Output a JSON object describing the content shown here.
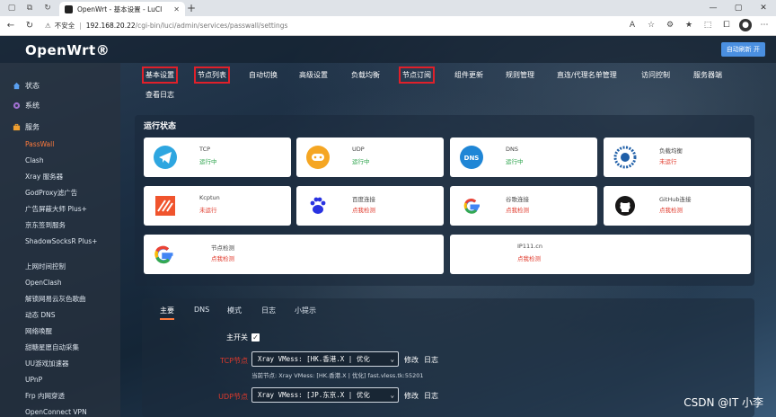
{
  "browser": {
    "tab_title": "OpenWrt - 基本设置 - LuCI",
    "url_warning": "不安全",
    "url_host": "192.168.20.22",
    "url_path": "/cgi-bin/luci/admin/services/passwall/settings"
  },
  "header": {
    "brand": "OpenWrt®",
    "auto_refresh": "自动刷新 开"
  },
  "sidebar": {
    "items": [
      {
        "label": "状态"
      },
      {
        "label": "系统"
      },
      {
        "label": "服务"
      }
    ],
    "services": [
      {
        "label": "PassWall"
      },
      {
        "label": "Clash"
      },
      {
        "label": "Xray 服务器"
      },
      {
        "label": "GodProxy滤广告"
      },
      {
        "label": "广告屏蔽大师 Plus+"
      },
      {
        "label": "京东签到服务"
      },
      {
        "label": "ShadowSocksR Plus+"
      },
      {
        "label": "上网时间控制"
      },
      {
        "label": "OpenClash"
      },
      {
        "label": "解锁网易云灰色歌曲"
      },
      {
        "label": "动态 DNS"
      },
      {
        "label": "网络唤醒"
      },
      {
        "label": "甜糖星愿自动采集"
      },
      {
        "label": "UU游戏加速器"
      },
      {
        "label": "UPnP"
      },
      {
        "label": "Frp 内网穿透"
      },
      {
        "label": "OpenConnect VPN"
      }
    ]
  },
  "nav_tabs": [
    {
      "label": "基本设置"
    },
    {
      "label": "节点列表"
    },
    {
      "label": "自动切换"
    },
    {
      "label": "高级设置"
    },
    {
      "label": "负载均衡"
    },
    {
      "label": "节点订阅"
    },
    {
      "label": "组件更新"
    },
    {
      "label": "规则管理"
    },
    {
      "label": "直连/代理名单管理"
    },
    {
      "label": "访问控制"
    },
    {
      "label": "服务器端"
    },
    {
      "label": "查看日志"
    }
  ],
  "status_panel": {
    "title": "运行状态",
    "cards": [
      {
        "name": "TCP",
        "status": "运行中"
      },
      {
        "name": "UDP",
        "status": "运行中"
      },
      {
        "name": "DNS",
        "status": "运行中"
      },
      {
        "name": "负载均衡",
        "status": "未运行"
      },
      {
        "name": "Kcptun",
        "status": "未运行"
      },
      {
        "name": "百度连接",
        "status": "点我检测"
      },
      {
        "name": "谷歌连接",
        "status": "点我检测"
      },
      {
        "name": "GitHub连接",
        "status": "点我检测"
      },
      {
        "name": "节点检测",
        "status": "点我检测"
      },
      {
        "name": "IP111.cn",
        "status": "点我检测"
      }
    ],
    "dns_logo_text": "DNS"
  },
  "settings": {
    "tabs": [
      {
        "label": "主要"
      },
      {
        "label": "DNS"
      },
      {
        "label": "模式"
      },
      {
        "label": "日志"
      },
      {
        "label": "小提示"
      }
    ],
    "main_switch_label": "主开关",
    "tcp_label": "TCP节点",
    "tcp_value": "Xray VMess: [HK.香港.X | 优化",
    "tcp_hint": "当前节点: Xray VMess: [HK.香港.X | 优化] fast.vless.tk:55201",
    "udp_label": "UDP节点",
    "udp_value": "Xray VMess: [JP.东京.X | 优化",
    "edit_label": "修改",
    "log_label": "日志"
  },
  "watermark": "CSDN @IT 小李",
  "colors": {
    "accent": "#ff7a3c",
    "highlight_box": "#e0202a",
    "running": "#2aa34a",
    "stopped": "#e0392b"
  }
}
